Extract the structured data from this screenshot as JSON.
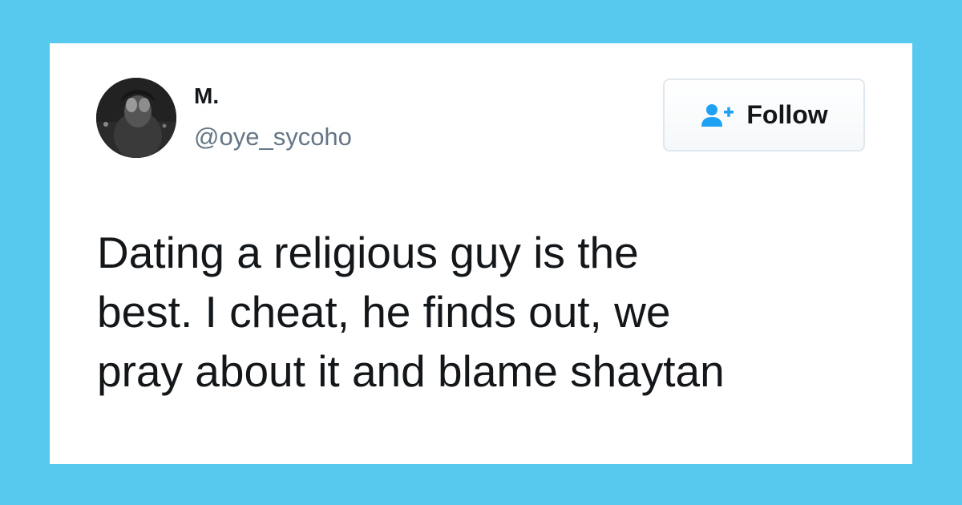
{
  "colors": {
    "background": "#57c8ee",
    "card": "#ffffff",
    "text_primary": "#14171a",
    "text_secondary": "#657786",
    "accent": "#1da1f2"
  },
  "author": {
    "display_name": "M.",
    "handle": "@oye_sycoho",
    "avatar_icon": "profile-photo"
  },
  "follow_button": {
    "label": "Follow",
    "icon": "add-user-icon"
  },
  "tweet": {
    "lines": [
      "Dating a religious guy is the",
      "best. I cheat, he finds out, we",
      "pray about it and blame shaytan"
    ]
  }
}
